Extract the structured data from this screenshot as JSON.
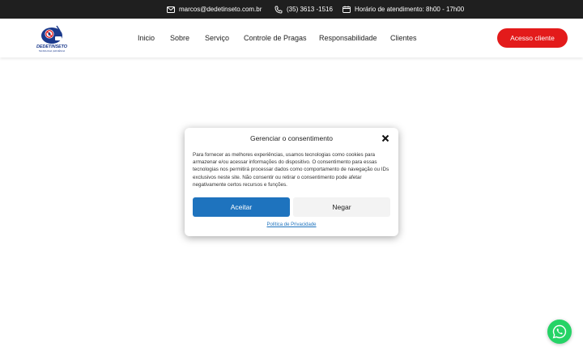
{
  "topbar": {
    "email": "marcos@dedetinseto.com.br",
    "phone": "(35) 3613 -1516",
    "hours": "Horário de atendimento: 8h00 - 17h00",
    "icons": [
      "envelope-icon",
      "phone-icon",
      "clock-icon"
    ]
  },
  "header": {
    "logo_text": "DEDETINSETO",
    "logo_sub": "TECNOLOGIA | EFICIÊNCIA",
    "nav": [
      "Inicio",
      "Sobre",
      "Serviço",
      "Controle de Pragas",
      "Responsabilidade",
      "Clientes"
    ],
    "cta": "Acesso cliente"
  },
  "consent": {
    "title": "Gerenciar o consentimento",
    "body": "Para fornecer as melhores experiências, usamos tecnologias como cookies para armazenar e/ou acessar informações do dispositivo. O consentimento para essas tecnologias nos permitirá processar dados como comportamento de navegação ou IDs exclusivos neste site. Não consentir ou retirar o consentimento pode afetar negativamente certos recursos e funções.",
    "accept": "Aceitar",
    "deny": "Negar",
    "privacy": "Política de Privacidade",
    "close_icon": "close-icon"
  },
  "colors": {
    "topbar": "#1f1f1f",
    "cta": "#e31b1b",
    "accept": "#1e73be",
    "whatsapp": "#25d366"
  }
}
